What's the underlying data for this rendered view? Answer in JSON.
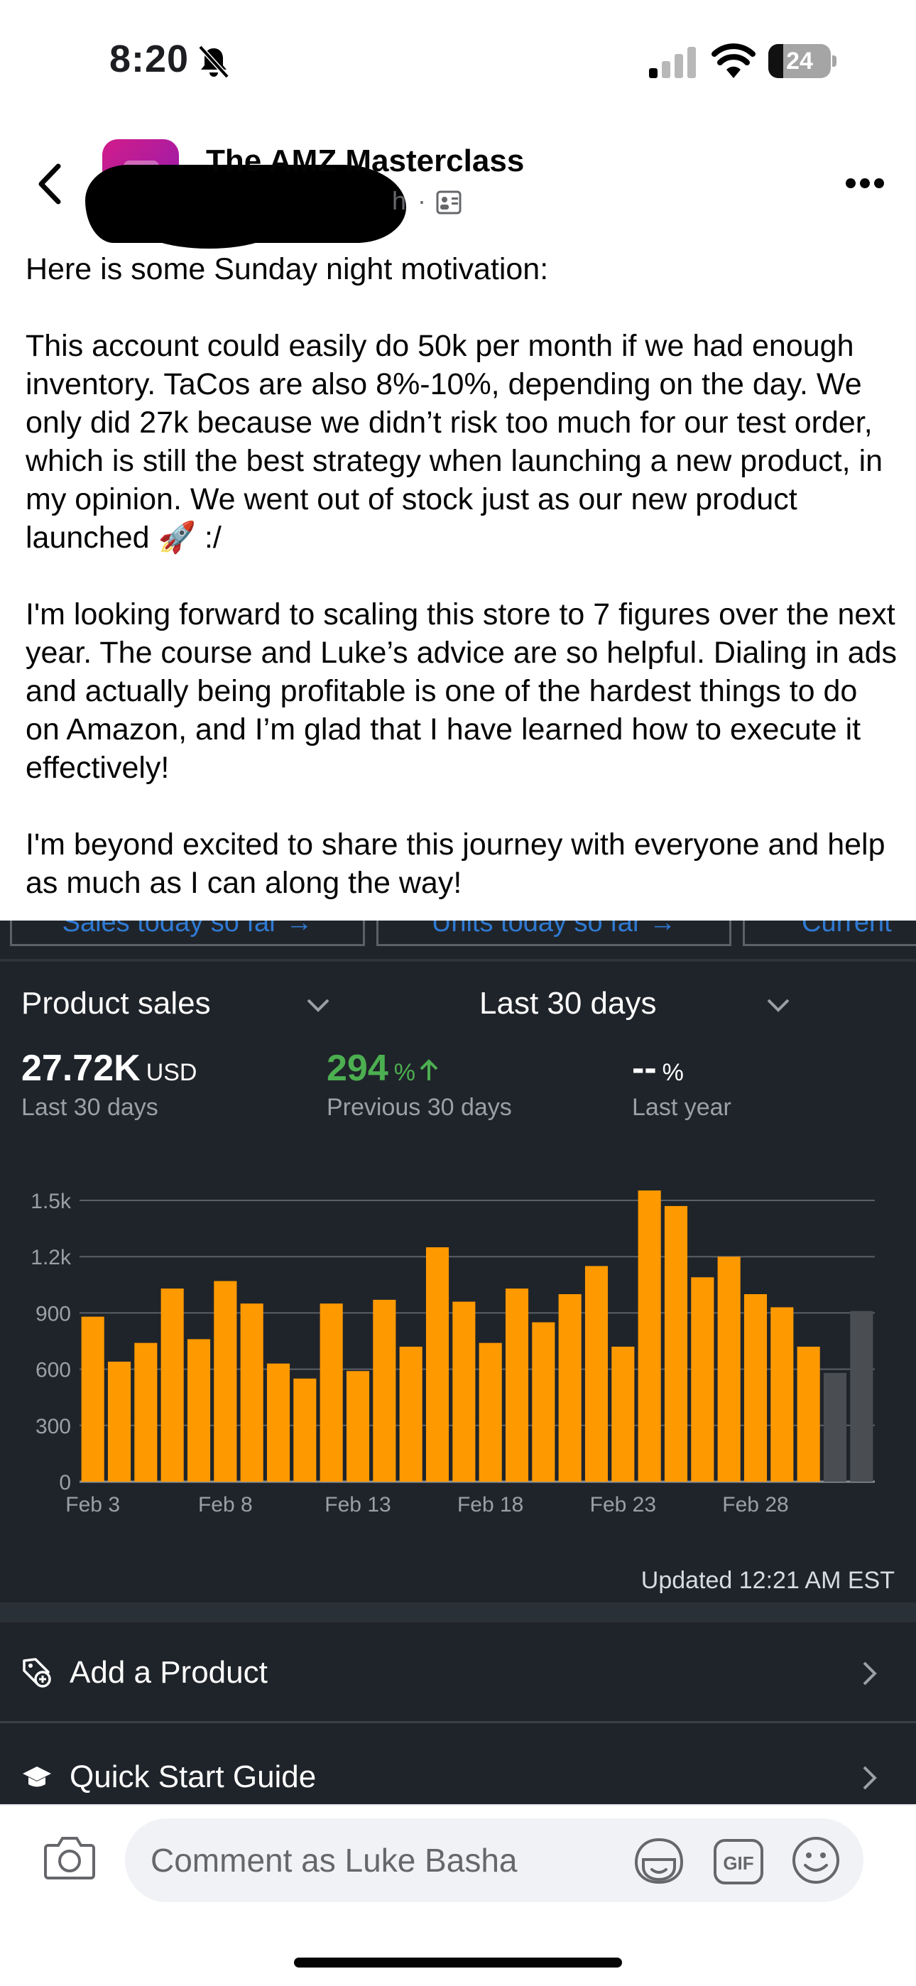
{
  "status_bar": {
    "time": "8:20",
    "battery": "24",
    "battery_level": 0.24
  },
  "post": {
    "page_name": "The AMZ Masterclass",
    "meta_suffix": "h",
    "paragraphs": [
      "Here is some Sunday night motivation:",
      "This account could easily do 50k per month if we had enough inventory. TaCos are also 8%-10%, depending on the day. We only did 27k because we didn’t risk too much for our test order, which is still the best strategy when launching a new product, in my opinion. We went out of stock just as our new product launched 🚀 :/",
      "I'm looking forward to scaling this store to 7 figures over the next year. The course and Luke’s advice are so helpful. Dialing in ads and actually being profitable is one of the hardest things to do on Amazon, and I’m glad that I have learned how to execute it effectively!",
      "I'm beyond excited to share this journey with everyone and help as much as I can along the way!"
    ]
  },
  "seller_app": {
    "tiles": [
      "Sales today so far →",
      "Units today so far →",
      "Current"
    ],
    "metric_dropdown": "Product sales",
    "range_dropdown": "Last 30 days",
    "metrics": [
      {
        "value": "27.72K",
        "unit": "USD",
        "label": "Last 30 days"
      },
      {
        "value": "294",
        "unit": "%",
        "label": "Previous 30 days"
      },
      {
        "value": "--",
        "unit": "%",
        "label": "Last year"
      }
    ],
    "updated": "Updated 12:21 AM EST",
    "list_items": [
      {
        "label": "Add a Product",
        "icon": "tag-plus-icon"
      },
      {
        "label": "Quick Start Guide",
        "icon": "graduation-cap-icon"
      }
    ]
  },
  "chart_data": {
    "type": "bar",
    "x_tick_labels": [
      "Feb 3",
      "Feb 8",
      "Feb 13",
      "Feb 18",
      "Feb 23",
      "Feb 28"
    ],
    "y_tick_labels": [
      "0",
      "300",
      "600",
      "900",
      "1.2k",
      "1.5k"
    ],
    "ylim": [
      0,
      1500
    ],
    "grid": true,
    "categories": [
      "Feb 3",
      "Feb 4",
      "Feb 5",
      "Feb 6",
      "Feb 7",
      "Feb 8",
      "Feb 9",
      "Feb 10",
      "Feb 11",
      "Feb 12",
      "Feb 13",
      "Feb 14",
      "Feb 15",
      "Feb 16",
      "Feb 17",
      "Feb 18",
      "Feb 19",
      "Feb 20",
      "Feb 21",
      "Feb 22",
      "Feb 23",
      "Feb 24",
      "Feb 25",
      "Feb 26",
      "Feb 27",
      "Feb 28",
      "Feb 29",
      "Mar 1",
      "Mar 2",
      "Mar 3",
      "Mar 4"
    ],
    "values": [
      880,
      640,
      740,
      1030,
      760,
      1070,
      950,
      630,
      550,
      950,
      590,
      970,
      720,
      1250,
      960,
      740,
      1030,
      850,
      1000,
      1150,
      720,
      1600,
      1470,
      1090,
      1200,
      1000,
      930,
      720,
      580,
      910
    ],
    "colors": {
      "bar": "#ff9900",
      "recent_bar": "#4a4d51"
    },
    "recent_count": 2
  },
  "comment_bar": {
    "placeholder": "Comment as Luke Basha"
  }
}
